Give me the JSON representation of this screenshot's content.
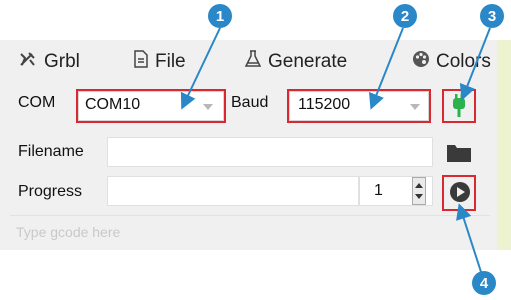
{
  "tabs": [
    {
      "label": "Grbl",
      "icon": "tools-icon"
    },
    {
      "label": "File",
      "icon": "file-icon"
    },
    {
      "label": "Generate",
      "icon": "flask-icon"
    },
    {
      "label": "Colors",
      "icon": "palette-icon"
    }
  ],
  "com": {
    "label": "COM",
    "value": "COM10"
  },
  "baud": {
    "label": "Baud",
    "value": "115200"
  },
  "filename": {
    "label": "Filename",
    "value": ""
  },
  "progress": {
    "label": "Progress",
    "value": "",
    "count": "1"
  },
  "command": {
    "placeholder": "Type gcode here"
  },
  "callouts": [
    "1",
    "2",
    "3",
    "4"
  ],
  "colors": {
    "highlight": "#d9282f",
    "callout": "#2a88c8",
    "connect": "#2bb24c"
  }
}
